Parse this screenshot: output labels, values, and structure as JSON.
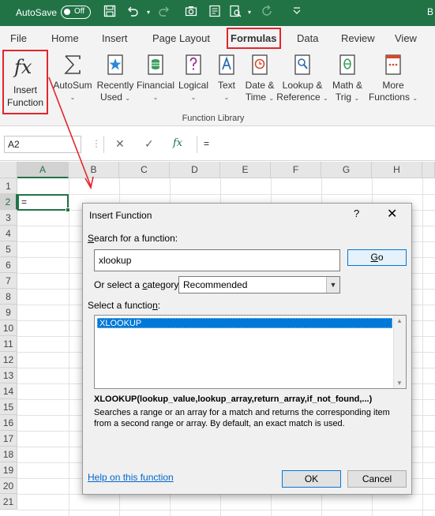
{
  "titlebar": {
    "autosave_label": "AutoSave",
    "toggle_state": "Off",
    "trailing_letter": "B"
  },
  "tabs": [
    "File",
    "Home",
    "Insert",
    "Page Layout",
    "Formulas",
    "Data",
    "Review",
    "View"
  ],
  "active_tab": "Formulas",
  "ribbon": {
    "insert_function": {
      "line1": "Insert",
      "line2": "Function"
    },
    "buttons": [
      {
        "line1": "AutoSum",
        "line2": ""
      },
      {
        "line1": "Recently",
        "line2": "Used"
      },
      {
        "line1": "Financial",
        "line2": ""
      },
      {
        "line1": "Logical",
        "line2": ""
      },
      {
        "line1": "Text",
        "line2": ""
      },
      {
        "line1": "Date &",
        "line2": "Time"
      },
      {
        "line1": "Lookup &",
        "line2": "Reference"
      },
      {
        "line1": "Math &",
        "line2": "Trig"
      },
      {
        "line1": "More",
        "line2": "Functions"
      }
    ],
    "group_label": "Function Library"
  },
  "formula_bar": {
    "name_box": "A2",
    "formula": "="
  },
  "grid": {
    "columns": [
      "A",
      "B",
      "C",
      "D",
      "E",
      "F",
      "G",
      "H"
    ],
    "rows": [
      "1",
      "2",
      "3",
      "4",
      "5",
      "6",
      "7",
      "8",
      "9",
      "10",
      "11",
      "12",
      "13",
      "14",
      "15",
      "16",
      "17",
      "18",
      "19",
      "20",
      "21"
    ],
    "active_cell_value": "="
  },
  "dialog": {
    "title": "Insert Function",
    "help": "?",
    "close": "✕",
    "search_label_pre": "S",
    "search_label_post": "earch for a function:",
    "search_value": "xlookup",
    "go_label": "Go",
    "category_label_pre": "Or select a ",
    "category_label_acc": "c",
    "category_label_post": "ategory:",
    "category_value": "Recommended",
    "select_label_pre": "Select a functio",
    "select_label_acc": "n",
    "select_label_post": ":",
    "functions": [
      "XLOOKUP"
    ],
    "signature": "XLOOKUP(lookup_value,lookup_array,return_array,if_not_found,...)",
    "description": "Searches a range or an array for a match and returns the corresponding item from a second range or array. By default, an exact match is used.",
    "help_link": "Help on this function",
    "ok_label": "OK",
    "cancel_label": "Cancel"
  },
  "colors": {
    "excel_green": "#217346",
    "highlight_red": "#e1262c",
    "selection_blue": "#0078d7",
    "link_blue": "#0066cc"
  }
}
